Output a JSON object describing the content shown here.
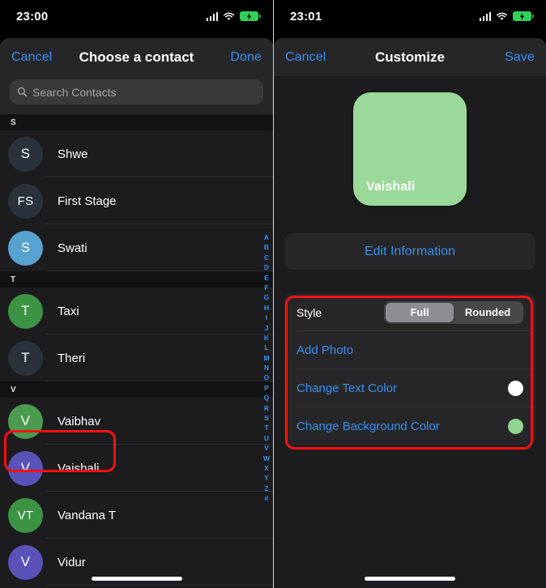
{
  "left_panel": {
    "status": {
      "time": "23:00",
      "signal_icon": "cellular-signal-icon",
      "wifi_icon": "wifi-icon",
      "battery_icon": "battery-charging-icon"
    },
    "navbar": {
      "cancel_label": "Cancel",
      "title": "Choose a contact",
      "done_label": "Done"
    },
    "search": {
      "icon": "search-icon",
      "placeholder": "Search Contacts",
      "value": ""
    },
    "sections": [
      {
        "letter": "S",
        "contacts": [
          {
            "initials": "S",
            "name": "Shwe",
            "color": "#29313a",
            "highlighted": false
          },
          {
            "initials": "FS",
            "name": "First Stage",
            "color": "#29313a",
            "highlighted": false
          },
          {
            "initials": "S",
            "name": "Swati",
            "color": "#58a2cf",
            "highlighted": false
          }
        ]
      },
      {
        "letter": "T",
        "contacts": [
          {
            "initials": "T",
            "name": "Taxi",
            "color": "#3c9343",
            "highlighted": false
          },
          {
            "initials": "T",
            "name": "Theri",
            "color": "#29313a",
            "highlighted": false
          }
        ]
      },
      {
        "letter": "V",
        "contacts": [
          {
            "initials": "V",
            "name": "Vaibhav",
            "color": "#4a9b4f",
            "highlighted": false
          },
          {
            "initials": "V",
            "name": "Vaishali",
            "color": "#5a51b9",
            "highlighted": true
          },
          {
            "initials": "VT",
            "name": "Vandana T",
            "color": "#3c9343",
            "highlighted": false
          },
          {
            "initials": "V",
            "name": "Vidur",
            "color": "#5a51b9",
            "highlighted": false
          }
        ]
      }
    ],
    "alpha_index": [
      "A",
      "B",
      "C",
      "D",
      "E",
      "F",
      "G",
      "H",
      "I",
      "J",
      "K",
      "L",
      "M",
      "N",
      "O",
      "P",
      "Q",
      "R",
      "S",
      "T",
      "U",
      "V",
      "W",
      "X",
      "Y",
      "Z",
      "#"
    ],
    "home_indicator": "home-indicator"
  },
  "right_panel": {
    "status": {
      "time": "23:01",
      "signal_icon": "cellular-signal-icon",
      "wifi_icon": "wifi-icon",
      "battery_icon": "battery-charging-icon"
    },
    "navbar": {
      "cancel_label": "Cancel",
      "title": "Customize",
      "save_label": "Save"
    },
    "poster": {
      "name": "Vaishali",
      "background_color": "#9ad99a",
      "text_color": "#ffffff"
    },
    "edit_information_label": "Edit Information",
    "options": {
      "style": {
        "label": "Style",
        "segments": [
          "Full",
          "Rounded"
        ],
        "selected": "Full"
      },
      "add_photo_label": "Add Photo",
      "change_text_color": {
        "label": "Change Text Color",
        "swatch_color": "#ffffff"
      },
      "change_background_color": {
        "label": "Change Background Color",
        "swatch_color": "#8fd48f"
      }
    },
    "home_indicator": "home-indicator"
  },
  "annotations": {
    "highlight_color": "#ff1010",
    "boxes": [
      "vaishali-contact-row-highlight",
      "customize-options-group-highlight"
    ]
  },
  "theme": {
    "accent_blue": "#3b8ef0",
    "sheet_bg": "#1c1c1e",
    "card_bg": "#262628",
    "battery_green": "#2fd158"
  }
}
